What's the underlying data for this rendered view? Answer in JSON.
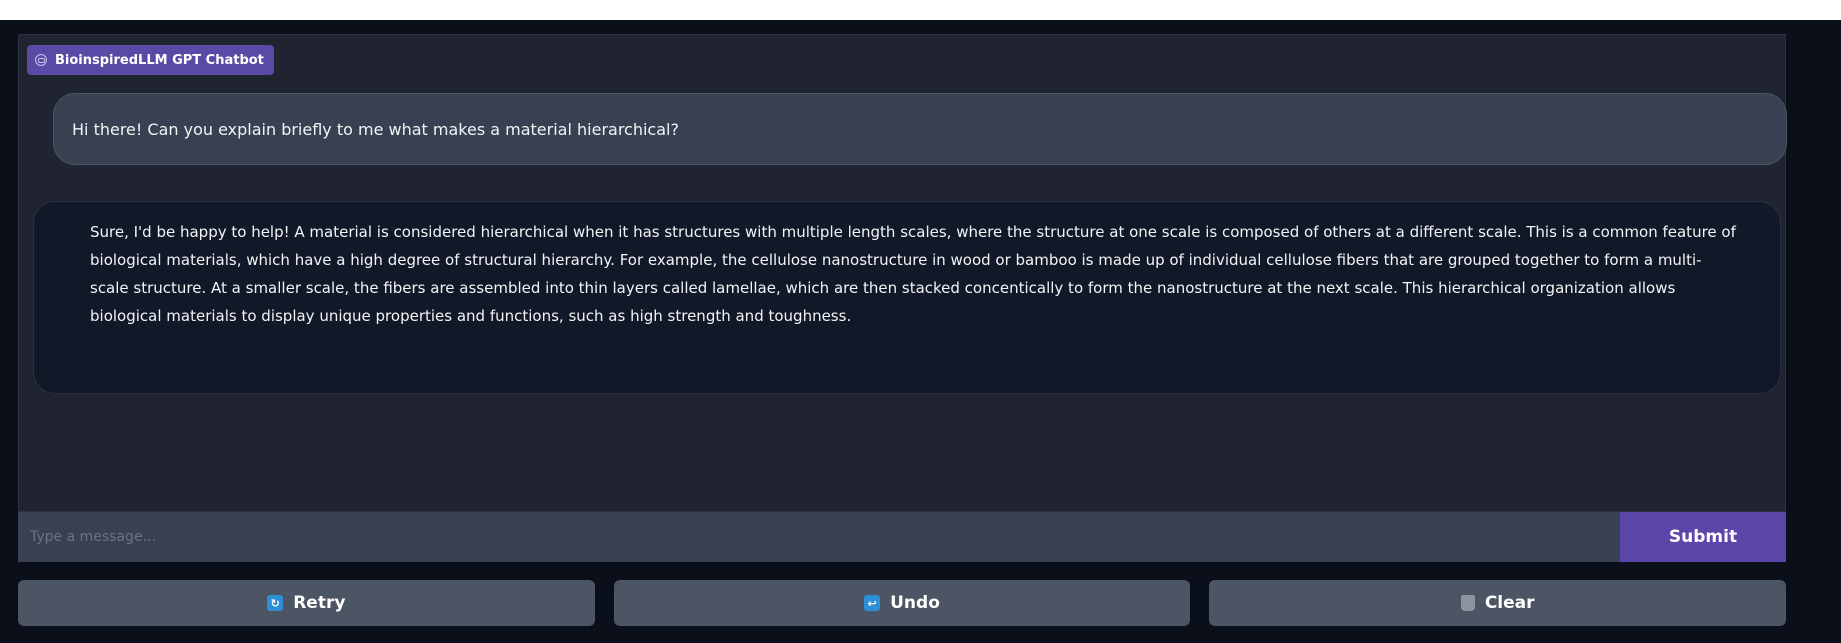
{
  "chatbot": {
    "label": "BioinspiredLLM GPT Chatbot",
    "label_icon": "chat-bubble-icon"
  },
  "messages": [
    {
      "role": "user",
      "text": "Hi there! Can you explain briefly to me what makes a material hierarchical?"
    },
    {
      "role": "bot",
      "text": "Sure, I'd be happy to help! A material is considered hierarchical when it has structures with multiple length scales, where the structure at one scale is composed of others at a different scale. This is a common feature of biological materials, which have a high degree of structural hierarchy. For example, the cellulose nanostructure in wood or bamboo is made up of individual cellulose fibers that are grouped together to form a multi-scale structure. At a smaller scale, the fibers are assembled into thin layers called lamellae, which are then stacked concentically to form the nanostructure at the next scale. This hierarchical organization allows biological materials to display unique properties and functions, such as high strength and toughness."
    }
  ],
  "input": {
    "placeholder": "Type a message...",
    "value": ""
  },
  "submit_label": "Submit",
  "buttons": {
    "retry": {
      "label": "Retry",
      "icon": "retry-icon"
    },
    "undo": {
      "label": "Undo",
      "icon": "undo-icon"
    },
    "clear": {
      "label": "Clear",
      "icon": "trash-icon"
    }
  },
  "colors": {
    "accent": "#5b45a8",
    "background": "#0b0f19",
    "panel": "#1f2430"
  }
}
